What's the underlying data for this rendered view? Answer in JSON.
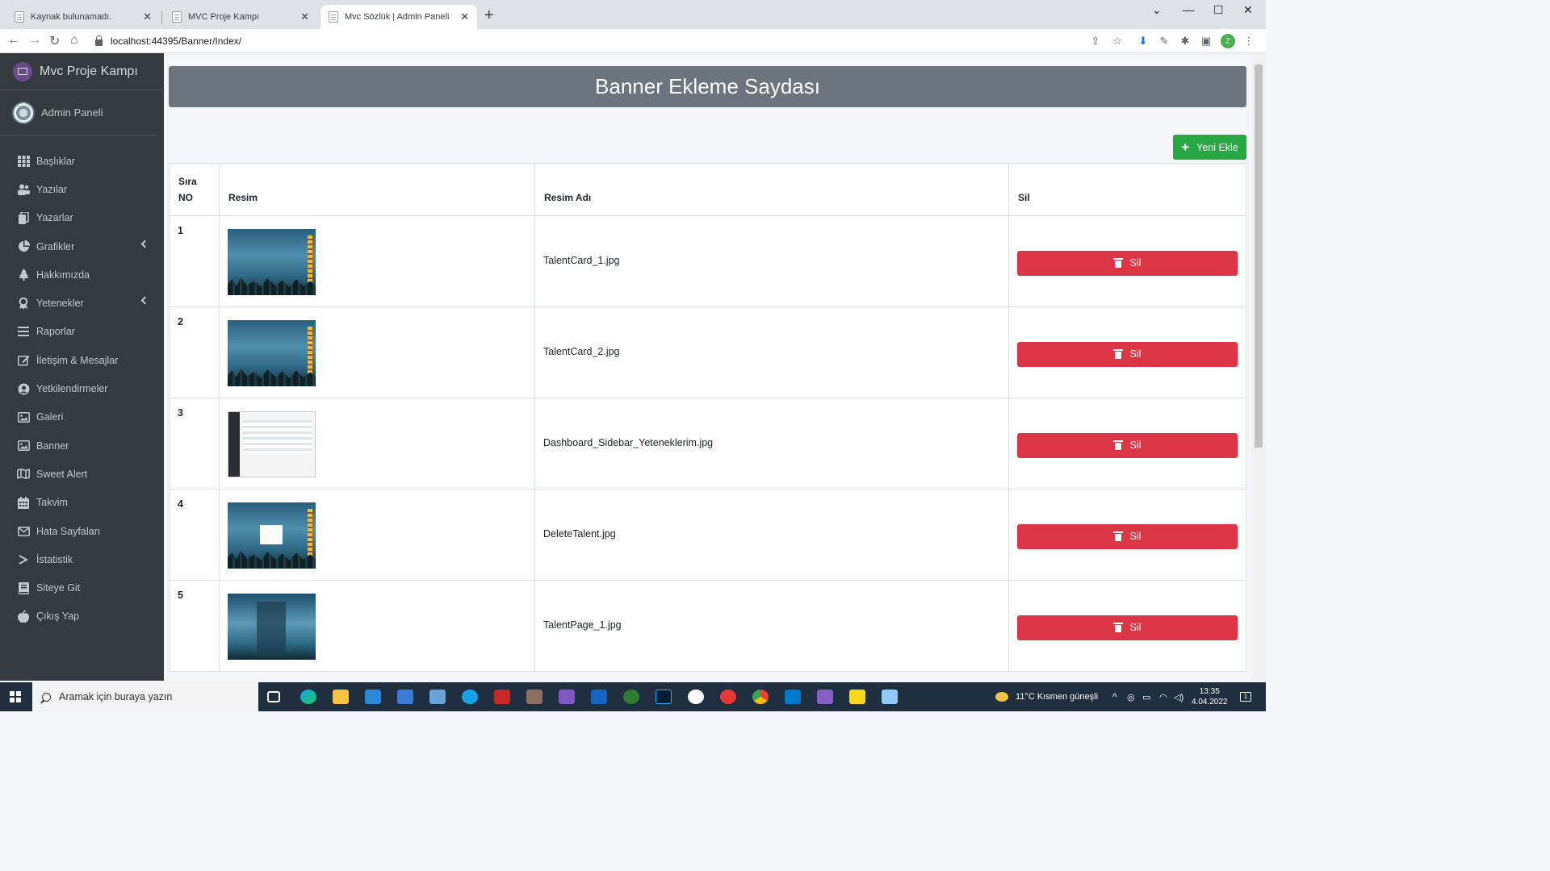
{
  "browser": {
    "tabs": [
      {
        "title": "Kaynak bulunamadı."
      },
      {
        "title": "MVC Proje Kampı"
      },
      {
        "title": "Mvc Sözlük | Admin Paneli"
      }
    ],
    "url": "localhost:44395/Banner/Index/",
    "profile_initial": "Z"
  },
  "sidebar": {
    "brand": "Mvc Proje Kampı",
    "user": "Admin Paneli",
    "items": [
      {
        "label": "Başlıklar",
        "icon": "grid-icon"
      },
      {
        "label": "Yazılar",
        "icon": "users-icon"
      },
      {
        "label": "Yazarlar",
        "icon": "copy-icon"
      },
      {
        "label": "Grafikler",
        "icon": "pie-chart-icon"
      },
      {
        "label": "Hakkımızda",
        "icon": "tree-icon"
      },
      {
        "label": "Yetenekler",
        "icon": "ribbon-icon"
      },
      {
        "label": "Raporlar",
        "icon": "bars-icon"
      },
      {
        "label": "İletişim & Mesajlar",
        "icon": "edit-icon"
      },
      {
        "label": "Yetkilendirmeler",
        "icon": "user-circle-icon"
      },
      {
        "label": "Galeri",
        "icon": "image-icon"
      },
      {
        "label": "Banner",
        "icon": "image-icon"
      },
      {
        "label": "Sweet Alert",
        "icon": "map-icon"
      },
      {
        "label": "Takvim",
        "icon": "calendar-icon"
      },
      {
        "label": "Hata Sayfaları",
        "icon": "envelope-icon"
      },
      {
        "label": "İstatistik",
        "icon": "chevron-right-icon"
      },
      {
        "label": "Siteye Git",
        "icon": "book-icon"
      },
      {
        "label": "Çıkış Yap",
        "icon": "apple-icon"
      }
    ]
  },
  "page": {
    "title": "Banner Ekleme Saydası",
    "add_button": "Yeni Ekle",
    "table": {
      "headers": {
        "no_line1": "Sıra",
        "no_line2": "NO",
        "image": "Resim",
        "name": "Resim Adı",
        "delete": "Sil"
      },
      "rows": [
        {
          "no": "1",
          "name": "TalentCard_1.jpg",
          "delete": "Sil"
        },
        {
          "no": "2",
          "name": "TalentCard_2.jpg",
          "delete": "Sil"
        },
        {
          "no": "3",
          "name": "Dashboard_Sidebar_Yeteneklerim.jpg",
          "delete": "Sil"
        },
        {
          "no": "4",
          "name": "DeleteTalent.jpg",
          "delete": "Sil"
        },
        {
          "no": "5",
          "name": "TalentPage_1.jpg",
          "delete": "Sil"
        }
      ]
    }
  },
  "taskbar": {
    "search_placeholder": "Aramak için buraya yazın",
    "weather": "11°C  Kısmen güneşli",
    "time": "13:35",
    "date": "4.04.2022",
    "notifications": "1"
  }
}
